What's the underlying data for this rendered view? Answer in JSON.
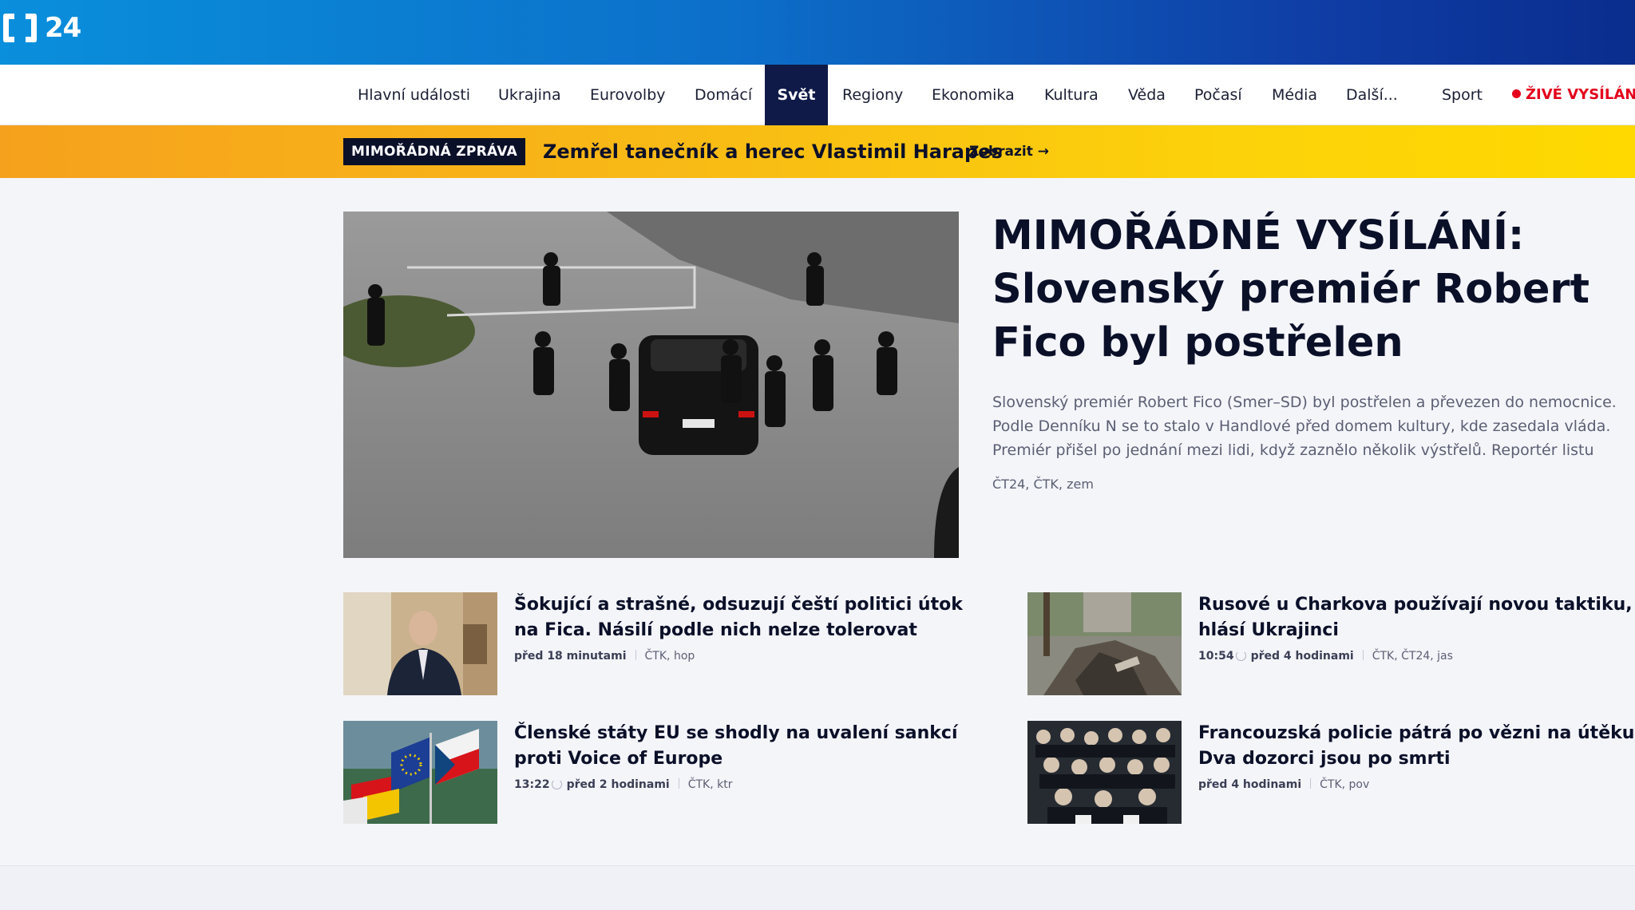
{
  "brand": {
    "logo_text": "24"
  },
  "nav": {
    "items": [
      {
        "label": "Hlavní události"
      },
      {
        "label": "Ukrajina"
      },
      {
        "label": "Eurovolby"
      },
      {
        "label": "Domácí"
      },
      {
        "label": "Svět",
        "active": true
      },
      {
        "label": "Regiony"
      },
      {
        "label": "Ekonomika"
      },
      {
        "label": "Kultura"
      },
      {
        "label": "Věda"
      },
      {
        "label": "Počasí"
      },
      {
        "label": "Média"
      },
      {
        "label": "Další..."
      },
      {
        "label": "Sport"
      }
    ],
    "live_label": "ŽIVÉ VYSÍLÁNÍ"
  },
  "breaking": {
    "badge": "MIMOŘÁDNÁ ZPRÁVA",
    "title": "Zemřel tanečník a herec Vlastimil Harapes",
    "link_label": "Zobrazit →"
  },
  "main_article": {
    "headline": "MIMOŘÁDNÉ VYSÍLÁNÍ: Slovenský premiér Robert Fico byl postřelen",
    "perex": "Slovenský premiér Robert Fico (Smer–SD) byl postřelen a převezen do nemocnice. Podle Denníku N se to stalo v Handlové před domem kultury, kde zasedala vláda. Premiér přišel po jednání mezi lidi, když zaznělo několik výstřelů. Reportér listu incident neviděl, ale byl...",
    "source": "ČT24, ČTK, zem"
  },
  "articles": [
    {
      "title": "Šokující a strašné, odsuzují čeští politici útok na Fica. Násilí podle nich nelze tolerovat",
      "time": "",
      "relative": "před 18 minutami",
      "source": "ČTK, hop"
    },
    {
      "title": "Rusové u Charkova používají novou taktiku, hlásí Ukrajinci",
      "time": "10:54",
      "relative": "před 4 hodinami",
      "source": "ČTK, ČT24, jas"
    },
    {
      "title": "Členské státy EU se shodly na uvalení sankcí proti Voice of Europe",
      "time": "13:22",
      "relative": "před 2 hodinami",
      "source": "ČTK, ktr"
    },
    {
      "title": "Francouzská policie pátrá po vězni na útěku. Dva dozorci jsou po smrti",
      "time": "",
      "relative": "před 4 hodinami",
      "source": "ČTK, pov"
    }
  ],
  "colors": {
    "header_start": "#0a8fdc",
    "header_end": "#0a2d8e",
    "nav_active": "#0f1a48",
    "live_red": "#e3001b",
    "breaking_start": "#f6a11d",
    "breaking_end": "#ffd900"
  }
}
